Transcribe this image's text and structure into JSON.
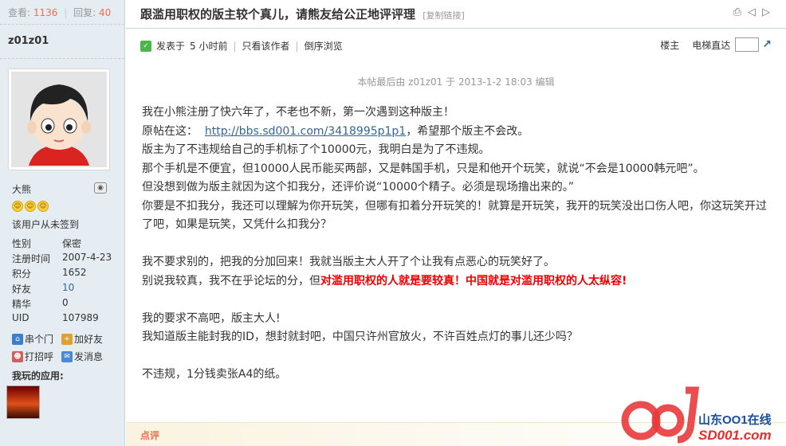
{
  "stats": {
    "views_label": "查看:",
    "views": "1136",
    "replies_label": "回复:",
    "replies": "40"
  },
  "author": {
    "name": "z01z01",
    "nickname": "大熊",
    "signin_text": "该用户从未签到",
    "profile": [
      {
        "key": "性别",
        "value": "保密"
      },
      {
        "key": "注册时间",
        "value": "2007-4-23"
      },
      {
        "key": "积分",
        "value": "1652"
      },
      {
        "key": "好友",
        "value": "10"
      },
      {
        "key": "精华",
        "value": "0"
      },
      {
        "key": "UID",
        "value": "107989"
      }
    ],
    "actions": [
      {
        "label": "串个门",
        "icon": "visit-icon"
      },
      {
        "label": "加好友",
        "icon": "add-friend-icon"
      },
      {
        "label": "打招呼",
        "icon": "greet-icon"
      },
      {
        "label": "发消息",
        "icon": "message-icon"
      }
    ],
    "apps_title": "我玩的应用:"
  },
  "thread": {
    "title": "跟滥用职权的版主较个真儿，请熊友给公正地评评理",
    "copy_link": "[复制链接]"
  },
  "post_meta": {
    "posted_label": "发表于",
    "posted_time": "5 小时前",
    "only_author": "只看该作者",
    "reverse": "倒序浏览",
    "floor_label": "楼主",
    "elevator_label": "电梯直达"
  },
  "edited_note": "本帖最后由 z01z01 于 2013-1-2 18:03 编辑",
  "content": {
    "p1": "我在小熊注册了快六年了，不老也不新，第一次遇到这种版主！",
    "p2_prefix": "原帖在这：",
    "p2_link": "http://bbs.sd001.com/3418995p1p1",
    "p2_suffix": "，希望那个版主不会改。",
    "p3": "版主为了不违规给自己的手机标了个10000元，我明白是为了不违规。",
    "p4": "那个手机是不便宜，但10000人民币能买两部，又是韩国手机，只是和他开个玩笑，就说“不会是10000韩元吧”。",
    "p5": "但没想到做为版主就因为这个扣我分，还评价说“10000个精子。必须是现场撸出来的。”",
    "p6": "你要是不扣我分，我还可以理解为你开玩笑，但哪有扣着分开玩笑的！就算是开玩笑，我开的玩笑没出口伤人吧，你这玩笑开过了吧，如果是玩笑，又凭什么扣我分？",
    "p7": "我不要求别的，把我的分加回来！我就当版主大人开了个让我有点恶心的玩笑好了。",
    "p8_prefix": "别说我较真，我不在乎论坛的分，但",
    "p8_red": "对滥用职权的人就是要较真！中国就是对滥用职权的人太纵容!",
    "p9": "我的要求不高吧，版主大人!",
    "p10": "我知道版主能封我的ID，想封就封吧，中国只许州官放火，不许百姓点灯的事儿还少吗？",
    "p11": "不违规，1分钱卖张A4的纸。"
  },
  "comment_label": "点评",
  "watermark": {
    "cn": "山东OO1在线",
    "en": "SD001.com"
  }
}
